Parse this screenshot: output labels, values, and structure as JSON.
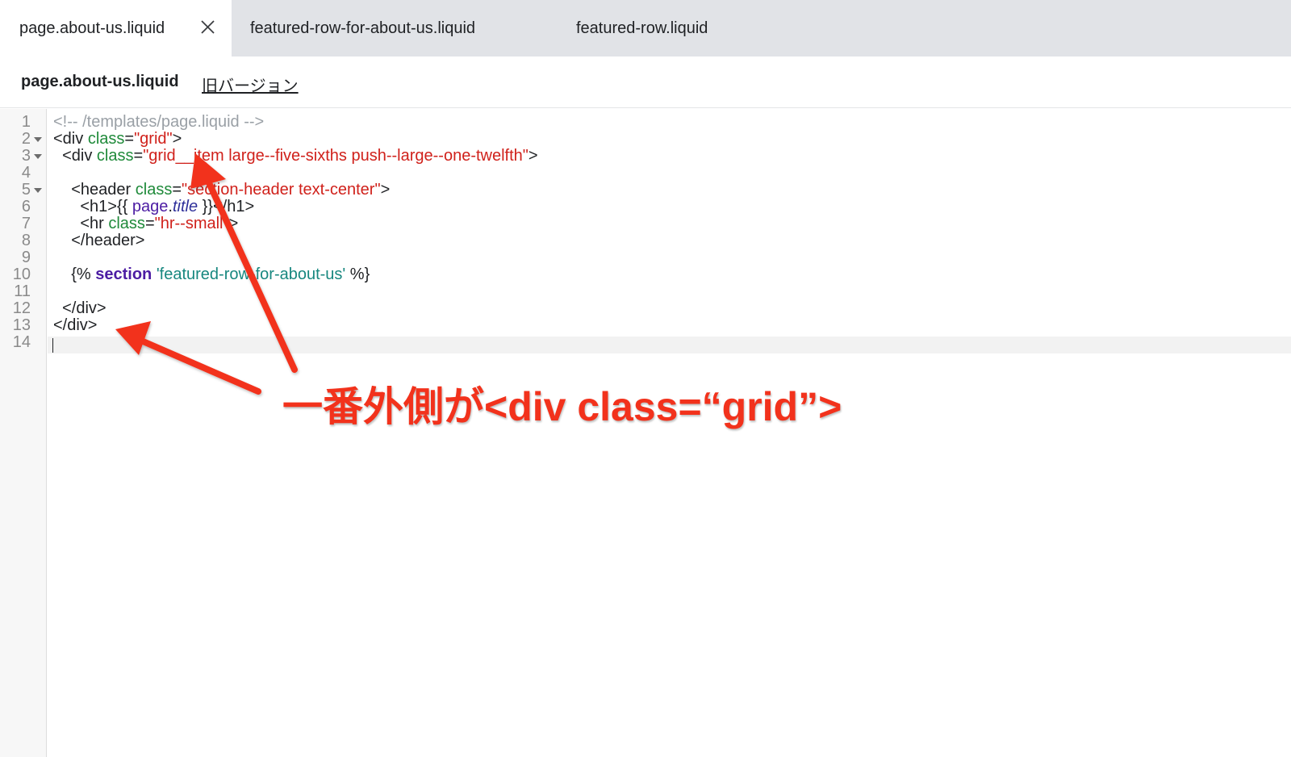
{
  "tabs": [
    {
      "label": "page.about-us.liquid",
      "active": true
    },
    {
      "label": "featured-row-for-about-us.liquid",
      "active": false
    },
    {
      "label": "featured-row.liquid",
      "active": false
    }
  ],
  "file_header": {
    "title": "page.about-us.liquid",
    "old_version_link": "旧バージョン"
  },
  "editor": {
    "line_numbers": [
      "1",
      "2",
      "3",
      "4",
      "5",
      "6",
      "7",
      "8",
      "9",
      "10",
      "11",
      "12",
      "13",
      "14"
    ],
    "fold_lines": [
      2,
      3,
      5
    ],
    "code": {
      "l1": "<!-- /templates/page.liquid -->",
      "l2_open": "<div ",
      "l2_attr": "class",
      "l2_eq": "=",
      "l2_val": "\"grid\"",
      "l2_close": ">",
      "l3_open": "  <div ",
      "l3_attr": "class",
      "l3_eq": "=",
      "l3_val": "\"grid__item large--five-sixths push--large--one-twelfth\"",
      "l3_close": ">",
      "l5_open": "    <header ",
      "l5_attr": "class",
      "l5_eq": "=",
      "l5_val": "\"section-header text-center\"",
      "l5_close": ">",
      "l6_open": "      <h1>{{ ",
      "l6_var": "page",
      "l6_dot": ".",
      "l6_prop": "title",
      "l6_close": " }}</h1>",
      "l7_open": "      <hr ",
      "l7_attr": "class",
      "l7_eq": "=",
      "l7_val": "\"hr--small\"",
      "l7_close": ">",
      "l8": "    </header>",
      "l10_open": "    {% ",
      "l10_kw": "section",
      "l10_sp": " ",
      "l10_str": "'featured-row-for-about-us'",
      "l10_close": " %}",
      "l12": "  </div>",
      "l13": "</div>"
    }
  },
  "annotation": {
    "text": "一番外側が<div class=“grid”>",
    "color": "#f2321c"
  },
  "colors": {
    "tabbar_bg": "#e1e3e7",
    "attr": "#1f8a3a",
    "string": "#d0211b",
    "keyword": "#4c1ca3",
    "liquid_string": "#17877f",
    "comment": "#9aa0a6"
  }
}
